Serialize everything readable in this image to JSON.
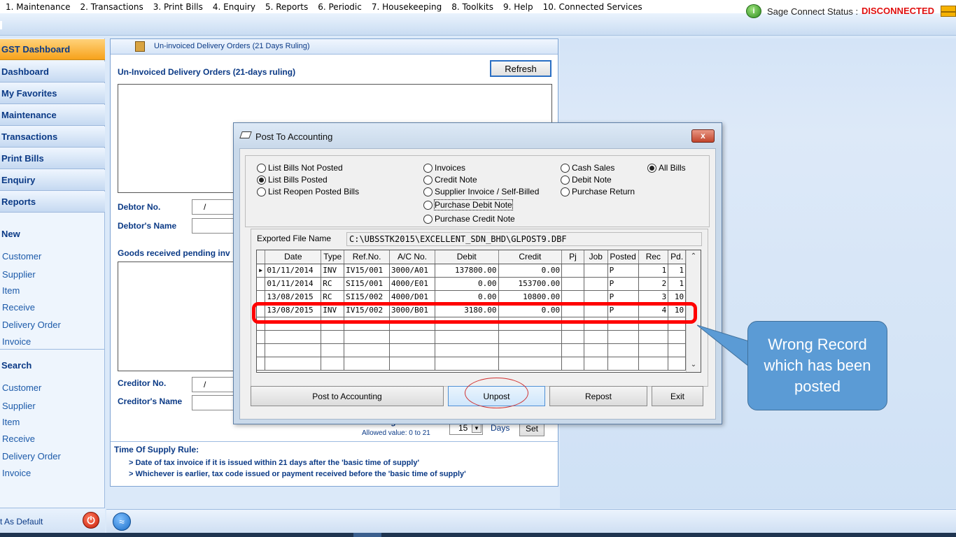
{
  "menubar": [
    "1. Maintenance",
    "2. Transactions",
    "3. Print Bills",
    "4. Enquiry",
    "5. Reports",
    "6. Periodic",
    "7. Housekeeping",
    "8. Toolkits",
    "9. Help",
    "10. Connected Services"
  ],
  "status": {
    "label": "Sage Connect Status :",
    "value": "DISCONNECTED"
  },
  "sidebar": {
    "nav": [
      "GST Dashboard",
      "Dashboard",
      "My Favorites",
      "Maintenance",
      "Transactions",
      "Print Bills",
      "Enquiry",
      "Reports"
    ],
    "new_heading": "New",
    "new_items": [
      "Customer",
      "Supplier",
      "Item",
      "Receive",
      "Delivery Order",
      "Invoice"
    ],
    "search_heading": "Search",
    "search_items": [
      "Customer",
      "Supplier",
      "Item",
      "Receive",
      "Delivery Order",
      "Invoice"
    ],
    "default_label": "t As Default"
  },
  "panel": {
    "tab_title": "Un-invoiced Delivery Orders (21 Days Ruling)",
    "heading": "Un-Invoiced Delivery Orders (21-days ruling)",
    "refresh": "Refresh",
    "debtor_no_label": "Debtor No.",
    "debtor_no_value": "/",
    "debtor_name_label": "Debtor's Name",
    "goods_heading": "Goods received pending inv",
    "creditor_no_label": "Creditor No.",
    "creditor_no_value": "/",
    "creditor_name_label": "Creditor's Name",
    "warning_label": "Warning Threshold",
    "allowed": "Allowed value: 0 to 21",
    "days_value": "15",
    "days_label": "Days",
    "set": "Set",
    "tos_heading": "Time Of Supply Rule:",
    "tos_line1": "> Date of tax invoice if it is issued within 21 days after the 'basic time of supply'",
    "tos_line2": "> Whichever is earlier, tax code issued or payment received before the 'basic time of supply'"
  },
  "dialog": {
    "title": "Post To Accounting",
    "close": "x",
    "list_options": [
      {
        "label": "List Bills Not Posted",
        "selected": false
      },
      {
        "label": "List Bills Posted",
        "selected": true
      },
      {
        "label": "List Reopen Posted Bills",
        "selected": false
      }
    ],
    "type_options_col1": [
      {
        "label": "Invoices",
        "selected": false
      },
      {
        "label": "Credit Note",
        "selected": false
      },
      {
        "label": "Supplier Invoice / Self-Billed",
        "selected": false
      },
      {
        "label": "Purchase Debit Note",
        "selected": false
      },
      {
        "label": "Purchase Credit Note",
        "selected": false
      }
    ],
    "type_options_col2": [
      {
        "label": "Cash Sales",
        "selected": false
      },
      {
        "label": "Debit Note",
        "selected": false
      },
      {
        "label": "Purchase Return",
        "selected": false
      }
    ],
    "all_bills": {
      "label": "All Bills",
      "selected": true
    },
    "exported_label": "Exported File Name",
    "exported_value": "C:\\UBSSTK2015\\EXCELLENT_SDN_BHD\\GLPOST9.DBF",
    "columns": [
      "Date",
      "Type",
      "Ref.No.",
      "A/C No.",
      "Debit",
      "Credit",
      "Pj",
      "Job",
      "Posted",
      "Rec",
      "Pd."
    ],
    "rows": [
      [
        "01/11/2014",
        "INV",
        "IV15/001",
        "3000/A01",
        "137800.00",
        "0.00",
        "",
        "",
        "P",
        "1",
        "1"
      ],
      [
        "01/11/2014",
        "RC",
        "SI15/001",
        "4000/E01",
        "0.00",
        "153700.00",
        "",
        "",
        "P",
        "2",
        "1"
      ],
      [
        "13/08/2015",
        "RC",
        "SI15/002",
        "4000/D01",
        "0.00",
        "10800.00",
        "",
        "",
        "P",
        "3",
        "10"
      ],
      [
        "13/08/2015",
        "INV",
        "IV15/002",
        "3000/B01",
        "3180.00",
        "0.00",
        "",
        "",
        "P",
        "4",
        "10"
      ]
    ],
    "buttons": [
      "Post to Accounting",
      "Unpost",
      "Repost",
      "Exit"
    ]
  },
  "annotation": {
    "callout": "Wrong Record which has been posted"
  },
  "colors": {
    "accent": "#2a6fc4",
    "disconnected": "#e01010",
    "highlight": "#ff0000",
    "callout": "#5b9bd5"
  }
}
